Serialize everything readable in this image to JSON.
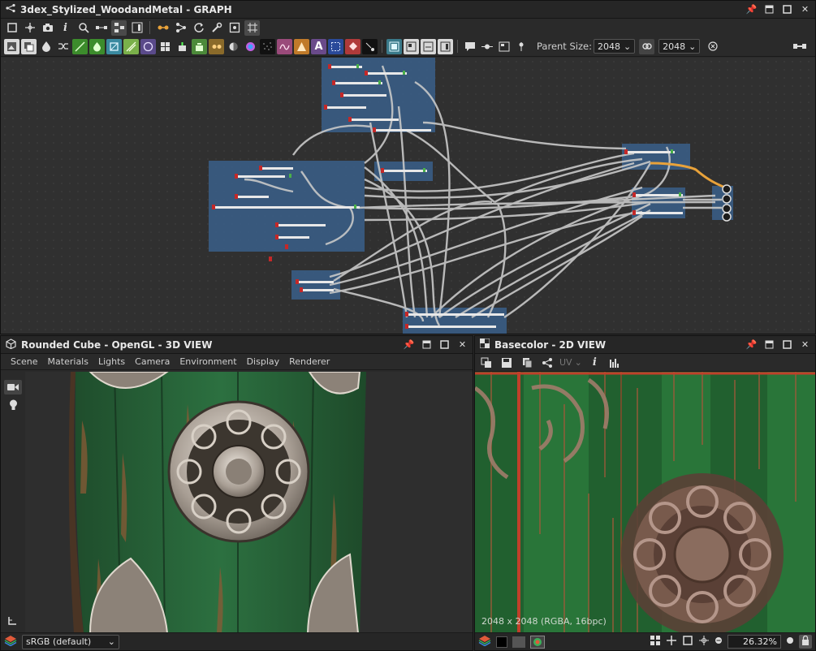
{
  "graph": {
    "title": "3dex_Stylized_WoodandMetal - GRAPH",
    "parent_size_label": "Parent Size:",
    "parent_size_w": "2048",
    "parent_size_h": "2048"
  },
  "view3d": {
    "title": "Rounded Cube - OpenGL - 3D VIEW",
    "menu": [
      "Scene",
      "Materials",
      "Lights",
      "Camera",
      "Environment",
      "Display",
      "Renderer"
    ],
    "colorspace": "sRGB (default)"
  },
  "view2d": {
    "title": "Basecolor - 2D VIEW",
    "uv_label": "UV",
    "resolution": "2048 x 2048 (RGBA, 16bpc)",
    "zoom": "26.32%"
  },
  "colors": {
    "node_frame": "#3a5f8a",
    "wire": "#c8c8c8",
    "wire_highlight": "#e8a23a",
    "wood_green": "#2a6a3a",
    "metal": "#bfb6ad"
  }
}
